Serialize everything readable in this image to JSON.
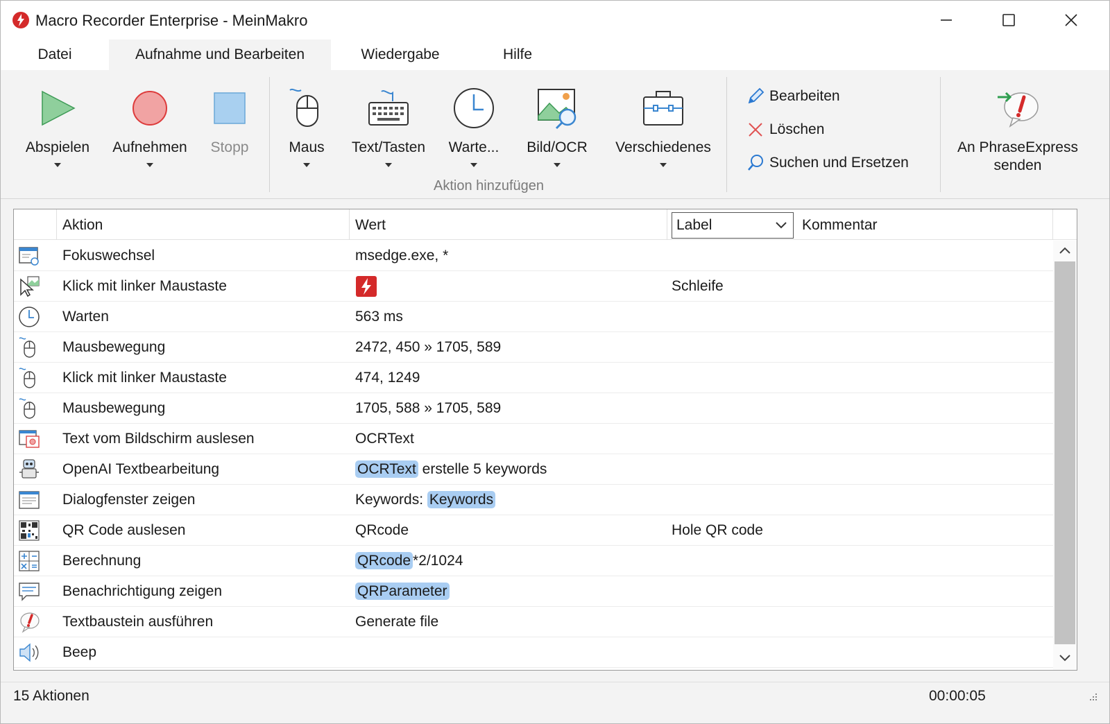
{
  "window": {
    "title": "Macro Recorder Enterprise - MeinMakro"
  },
  "tabs": [
    {
      "label": "Datei"
    },
    {
      "label": "Aufnahme und Bearbeiten"
    },
    {
      "label": "Wiedergabe"
    },
    {
      "label": "Hilfe"
    }
  ],
  "ribbon": {
    "play": "Abspielen",
    "record": "Aufnehmen",
    "stop": "Stopp",
    "mouse": "Maus",
    "text_keys": "Text/Tasten",
    "wait": "Warte...",
    "image_ocr": "Bild/OCR",
    "misc": "Verschiedenes",
    "group_add_action": "Aktion hinzufügen",
    "edit": "Bearbeiten",
    "delete": "Löschen",
    "search_replace": "Suchen und Ersetzen",
    "send_phraseexpress_1": "An PhraseExpress",
    "send_phraseexpress_2": "senden"
  },
  "table": {
    "headers": {
      "action": "Aktion",
      "value": "Wert",
      "label": "Label",
      "comment": "Kommentar"
    },
    "rows": [
      {
        "icon": "window-focus-icon",
        "action": "Fokuswechsel",
        "value": "msedge.exe, *",
        "label": ""
      },
      {
        "icon": "cursor-image-icon",
        "action": "Klick mit linker Maustaste",
        "value": "",
        "value_image": "app-logo-thumbnail",
        "label": "Schleife"
      },
      {
        "icon": "clock-icon",
        "action": "Warten",
        "value": "563 ms",
        "label": ""
      },
      {
        "icon": "mouse-icon",
        "action": "Mausbewegung",
        "value": "2472, 450 » 1705, 589",
        "label": ""
      },
      {
        "icon": "mouse-icon",
        "action": "Klick mit linker Maustaste",
        "value": "474, 1249",
        "label": ""
      },
      {
        "icon": "mouse-icon",
        "action": "Mausbewegung",
        "value": "1705, 588 » 1705, 589",
        "label": ""
      },
      {
        "icon": "screen-ocr-icon",
        "action": "Text vom Bildschirm auslesen",
        "value": "OCRText",
        "label": ""
      },
      {
        "icon": "robot-icon",
        "action": "OpenAI Textbearbeitung",
        "value_var": "OCRText",
        "value": " erstelle 5 keywords",
        "label": ""
      },
      {
        "icon": "dialog-icon",
        "action": "Dialogfenster zeigen",
        "value_prefix": "Keywords: ",
        "value_var": "Keywords",
        "label": ""
      },
      {
        "icon": "qr-code-icon",
        "action": "QR Code auslesen",
        "value": "QRcode",
        "label": "Hole QR code"
      },
      {
        "icon": "calculator-icon",
        "action": "Berechnung",
        "value_var": "QRcode",
        "value": "*2/1024",
        "label": ""
      },
      {
        "icon": "speech-bubble-icon",
        "action": "Benachrichtigung zeigen",
        "value_var": "QRParameter",
        "label": ""
      },
      {
        "icon": "phraseexpress-icon",
        "action": "Textbaustein ausführen",
        "value": "Generate file",
        "label": ""
      },
      {
        "icon": "speaker-icon",
        "action": "Beep",
        "value": "",
        "label": ""
      }
    ]
  },
  "status": {
    "count": "15 Aktionen",
    "time": "00:00:05"
  },
  "colors": {
    "accent": "#2b79d1",
    "variable_chip": "#a9cdf2",
    "logo_red": "#d42a2a",
    "play_green": "#8fcf9c",
    "record_red": "#f1a3a3",
    "stop_blue": "#a9d0f0"
  }
}
